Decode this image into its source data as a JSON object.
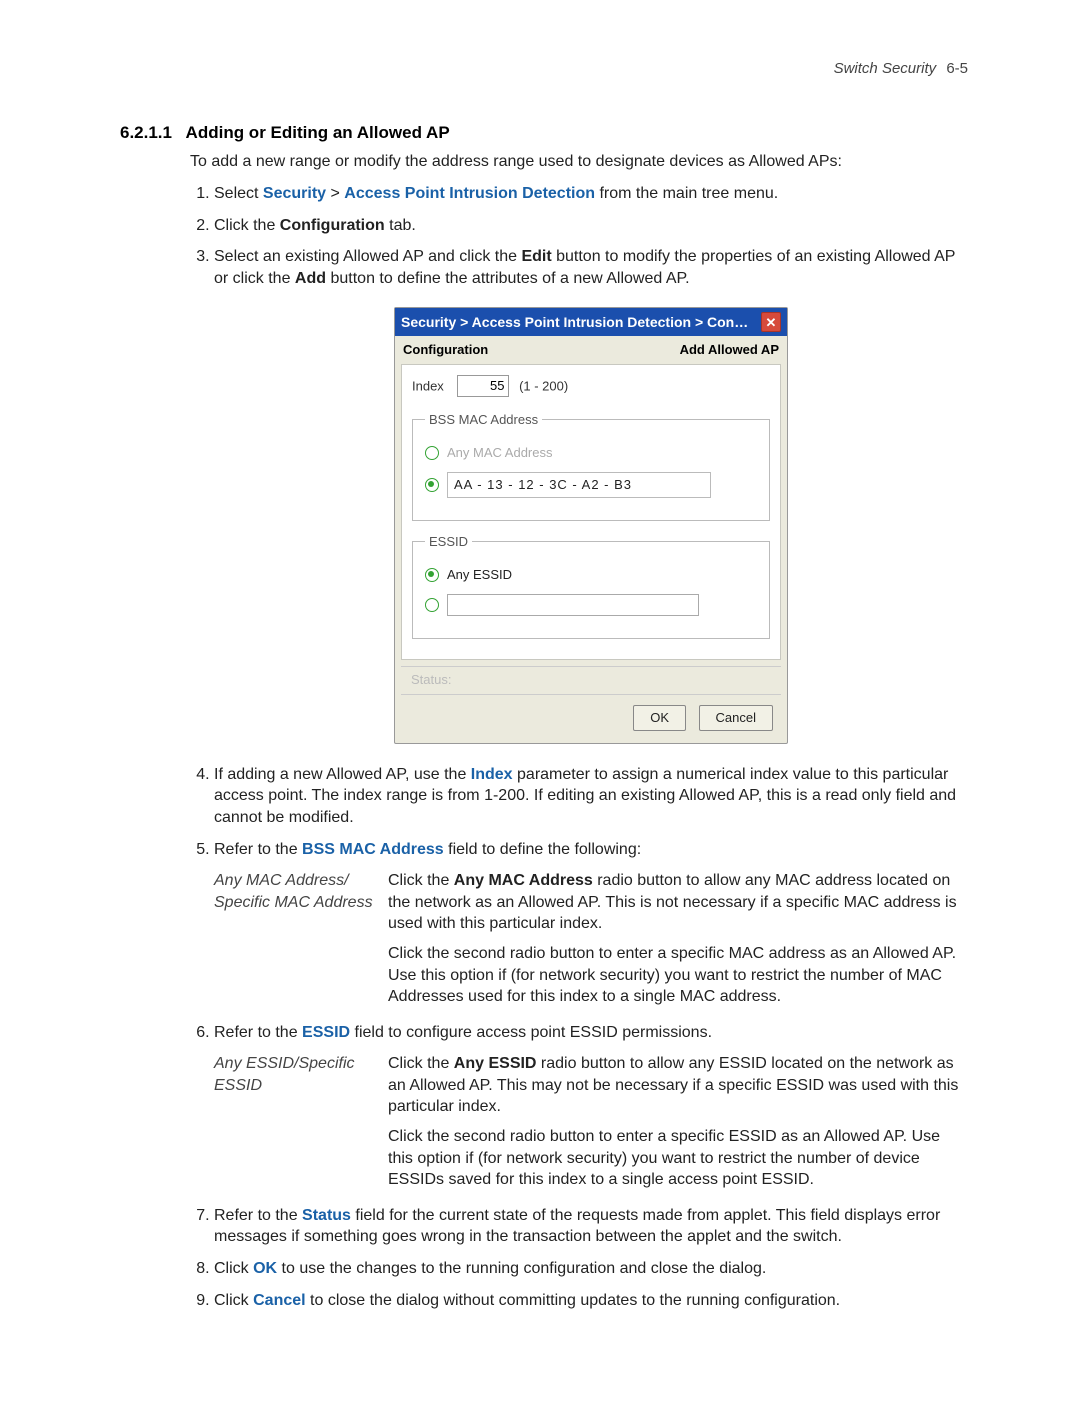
{
  "header": {
    "section": "Switch Security",
    "page": "6-5"
  },
  "title": {
    "number": "6.2.1.1",
    "text": "Adding or Editing an Allowed AP"
  },
  "intro": "To add a new range or modify the address range used to designate devices as Allowed APs:",
  "steps": {
    "s1_pre": "Select ",
    "s1_link1": "Security",
    "s1_sep": " > ",
    "s1_link2": "Access Point Intrusion Detection",
    "s1_post": " from the main tree menu.",
    "s2_pre": "Click the ",
    "s2_bold": "Configuration",
    "s2_post": " tab.",
    "s3_pre": "Select an existing Allowed AP and click the ",
    "s3_bold1": "Edit",
    "s3_mid": " button to modify the properties of an existing Allowed AP or click the ",
    "s3_bold2": "Add",
    "s3_post": " button to define the attributes of a new Allowed AP.",
    "s4_pre": "If adding a new Allowed AP, use the ",
    "s4_bold": "Index",
    "s4_post": " parameter to assign a numerical index value to this particular access point. The index range is from 1-200. If editing an existing Allowed AP, this is a read only field and cannot be modified.",
    "s5_pre": "Refer to the ",
    "s5_bold": "BSS MAC Address",
    "s5_post": " field to define the following:",
    "s6_pre": "Refer to the ",
    "s6_bold": "ESSID",
    "s6_post": " field to configure access point ESSID permissions.",
    "s7_pre": "Refer to the ",
    "s7_bold": "Status",
    "s7_post": " field for the current state of the requests made from applet. This field displays error messages if something goes wrong in the transaction between the applet and the switch.",
    "s8_pre": "Click ",
    "s8_bold": "OK",
    "s8_post": " to use the changes to the running configuration and close the dialog.",
    "s9_pre": "Click ",
    "s9_bold": "Cancel",
    "s9_post": " to close the dialog without committing updates to the running configuration."
  },
  "dialog": {
    "title": "Security > Access Point Intrusion Detection > Con…",
    "subleft": "Configuration",
    "subright": "Add Allowed AP",
    "index_label": "Index",
    "index_value": "55",
    "index_hint": "(1 - 200)",
    "bss_legend": "BSS MAC Address",
    "bss_any": "Any MAC Address",
    "bss_mac": "AA  -  13  -  12  -  3C  -  A2  -  B3",
    "essid_legend": "ESSID",
    "essid_any": "Any ESSID",
    "status_label": "Status:",
    "ok": "OK",
    "cancel": "Cancel"
  },
  "table1": {
    "term": "Any MAC Address/ Specific MAC Address",
    "p1a": "Click the ",
    "p1b": "Any MAC Address",
    "p1c": " radio button to allow any MAC address located on the network as an Allowed AP. This is not necessary if a specific MAC address is used with this particular index.",
    "p2": "Click the second radio button to enter a specific MAC address as an Allowed AP. Use this option if (for network security) you want to restrict the number of MAC Addresses used for this index to a single MAC address."
  },
  "table2": {
    "term": "Any ESSID/Specific ESSID",
    "p1a": "Click the ",
    "p1b": "Any ESSID",
    "p1c": " radio button to allow any ESSID located on the network as an Allowed AP. This may not be necessary if a specific ESSID was used with this particular index.",
    "p2": "Click the second radio button to enter a specific ESSID as an Allowed AP. Use this option if (for network security) you want to restrict the number of device ESSIDs saved for this index to a single access point ESSID."
  }
}
